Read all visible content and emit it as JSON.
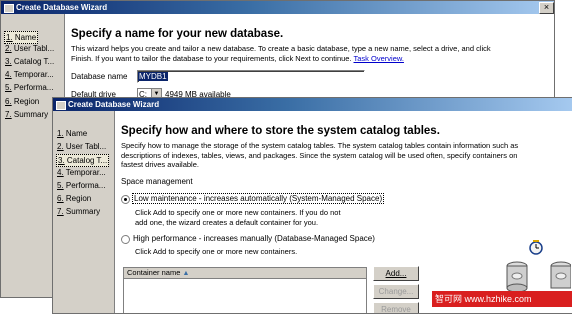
{
  "back_window": {
    "title": "Create Database Wizard",
    "close": "×",
    "nav": [
      {
        "num": "1.",
        "label": "Name",
        "selected": true
      },
      {
        "num": "2.",
        "label": "User Tabl...",
        "selected": false
      },
      {
        "num": "3.",
        "label": "Catalog T...",
        "selected": false
      },
      {
        "num": "4.",
        "label": "Temporar...",
        "selected": false
      },
      {
        "num": "5.",
        "label": "Performa...",
        "selected": false
      },
      {
        "num": "6.",
        "label": "Region",
        "selected": false
      },
      {
        "num": "7.",
        "label": "Summary",
        "selected": false
      }
    ],
    "heading": "Specify a name for your new database.",
    "description_1": "This wizard helps you create and tailor a new database. To create a basic database, type a new name, select a drive, and click",
    "description_2": "Finish. If you want to tailor the database to your requirements, click Next to continue.",
    "overview_link": "Task Overview.",
    "db_name_label": "Database name",
    "db_name_value": "MYDB1",
    "drive_label": "Default drive",
    "drive_value": "C:",
    "drive_available": "4949 MB available"
  },
  "front_window": {
    "title": "Create Database Wizard",
    "nav": [
      {
        "num": "1.",
        "label": "Name",
        "selected": false
      },
      {
        "num": "2.",
        "label": "User Tabl...",
        "selected": false
      },
      {
        "num": "3.",
        "label": "Catalog T...",
        "selected": true
      },
      {
        "num": "4.",
        "label": "Temporar...",
        "selected": false
      },
      {
        "num": "5.",
        "label": "Performa...",
        "selected": false
      },
      {
        "num": "6.",
        "label": "Region",
        "selected": false
      },
      {
        "num": "7.",
        "label": "Summary",
        "selected": false
      }
    ],
    "heading": "Specify how and where to store the system catalog tables.",
    "description_1": "Specify how to manage the storage of the system catalog tables. The system catalog tables contain information such as",
    "description_2": "descriptions of indexes, tables, views, and packages. Since the system catalog will be used often, specify containers on",
    "description_3": "fastest drives available.",
    "space_mgmt_label": "Space management",
    "option_low": "Low maintenance - increases automatically (System-Managed Space)",
    "option_low_help_1": "Click Add to specify one or more new containers. If you do not",
    "option_low_help_2": "add one, the wizard creates a default container for you.",
    "option_high": "High performance - increases manually (Database-Managed Space)",
    "option_high_help": "Click Add to specify one or more new containers.",
    "table_col_header": "Container name",
    "sort_icon": "▲",
    "add_button": "Add...",
    "change_button": "Change...",
    "remove_button": "Remove"
  },
  "watermark": "智可网 www.hzhike.com",
  "colors": {
    "titlebar_start": "#0a246a",
    "titlebar_end": "#a6caf0",
    "panel": "#d4d0c8",
    "link": "#0000cc",
    "watermark": "#d91f1f"
  }
}
